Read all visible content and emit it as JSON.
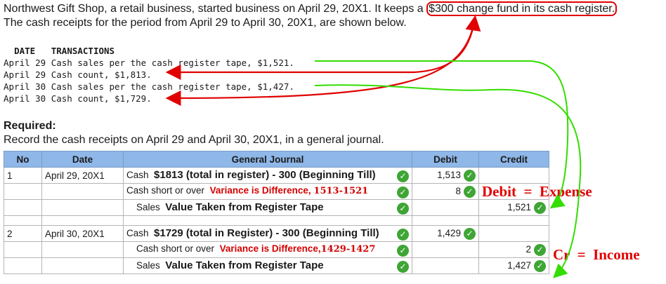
{
  "intro": {
    "line1_pre": "Northwest Gift Shop, a retail business, started business on April 29, 20X1. It keeps a",
    "line1_highlight": "$300 change fund in its cash register.",
    "line2": "The cash receipts for the period from April 29 to April 30, 20X1, are shown below."
  },
  "transactions": {
    "header_date": "DATE",
    "header_tx": "TRANSACTIONS",
    "rows": [
      "April 29 Cash sales per the cash register tape, $1,521.",
      "April 29 Cash count, $1,813.",
      "April 30 Cash sales per the cash register tape, $1,427.",
      "April 30 Cash count, $1,729."
    ]
  },
  "required": {
    "title": "Required:",
    "text": "Record the cash receipts on April 29 and April 30, 20X1, in a general journal."
  },
  "table": {
    "headers": [
      "No",
      "Date",
      "General Journal",
      "Debit",
      "Credit"
    ],
    "entry1": {
      "no": "1",
      "date": "April 29, 20X1",
      "r1_account": "Cash",
      "r1_note": "$1813 (total in register) - 300 (Beginning Till)",
      "r1_debit": "1,513",
      "r2_account": "Cash short or over",
      "r2_note_a": "Variance is Difference,",
      "r2_note_b": "1513-1521",
      "r2_debit": "8",
      "r3_account": "Sales",
      "r3_note": "Value Taken from Register Tape",
      "r3_credit": "1,521"
    },
    "entry2": {
      "no": "2",
      "date": "April 30, 20X1",
      "r1_account": "Cash",
      "r1_note": "$1729 (total in Register) - 300 (Beginning Till)",
      "r1_debit": "1,429",
      "r2_account": "Cash short or over",
      "r2_note_a": "Variance is Difference,",
      "r2_note_b": "1429-1427",
      "r2_credit": "2",
      "r3_account": "Sales",
      "r3_note": "Value Taken from Register Tape",
      "r3_credit": "1,427"
    }
  },
  "annotations": {
    "debit_expense": "Debit  =  Expense",
    "cr_income": "Cr  =  Income"
  },
  "colors": {
    "header_blue": "#8fb7e8",
    "check_green": "#3fa535",
    "annotation_red": "#e00000",
    "arrow_green": "#33dd00"
  }
}
